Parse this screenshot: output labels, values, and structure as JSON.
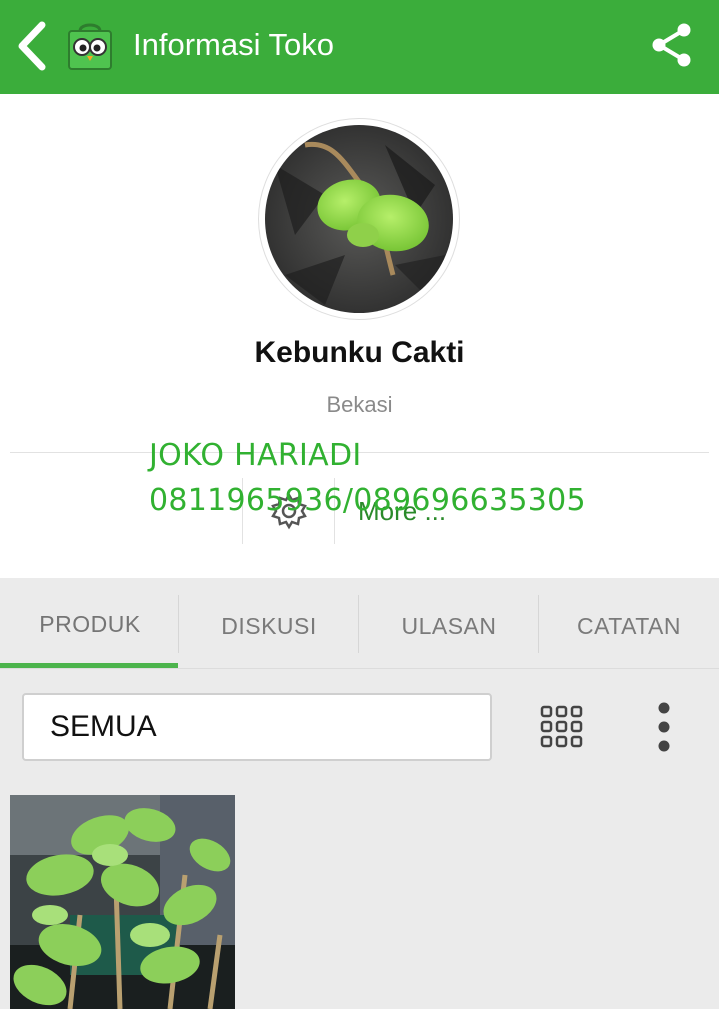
{
  "appbar": {
    "title": "Informasi Toko",
    "back_icon": "chevron-left-icon",
    "logo_icon": "owl-shopping-bag-logo",
    "share_icon": "share-icon",
    "color": "#3bad3b"
  },
  "shop": {
    "name": "Kebunku Cakti",
    "city": "Bekasi",
    "more_label": "More ...",
    "settings_icon": "gear-icon"
  },
  "overlay": {
    "owner_name": "JOKO HARIADI",
    "owner_phone": "0811965936/089696635305",
    "color": "#31b131"
  },
  "tabs": [
    {
      "label": "PRODUK",
      "active": true
    },
    {
      "label": "DISKUSI",
      "active": false
    },
    {
      "label": "ULASAN",
      "active": false
    },
    {
      "label": "CATATAN",
      "active": false
    }
  ],
  "filter": {
    "selected": "SEMUA",
    "grid_icon": "grid-view-icon",
    "menu_icon": "more-vertical-icon"
  },
  "products": [
    {
      "image": "fig-plant-photo"
    }
  ]
}
